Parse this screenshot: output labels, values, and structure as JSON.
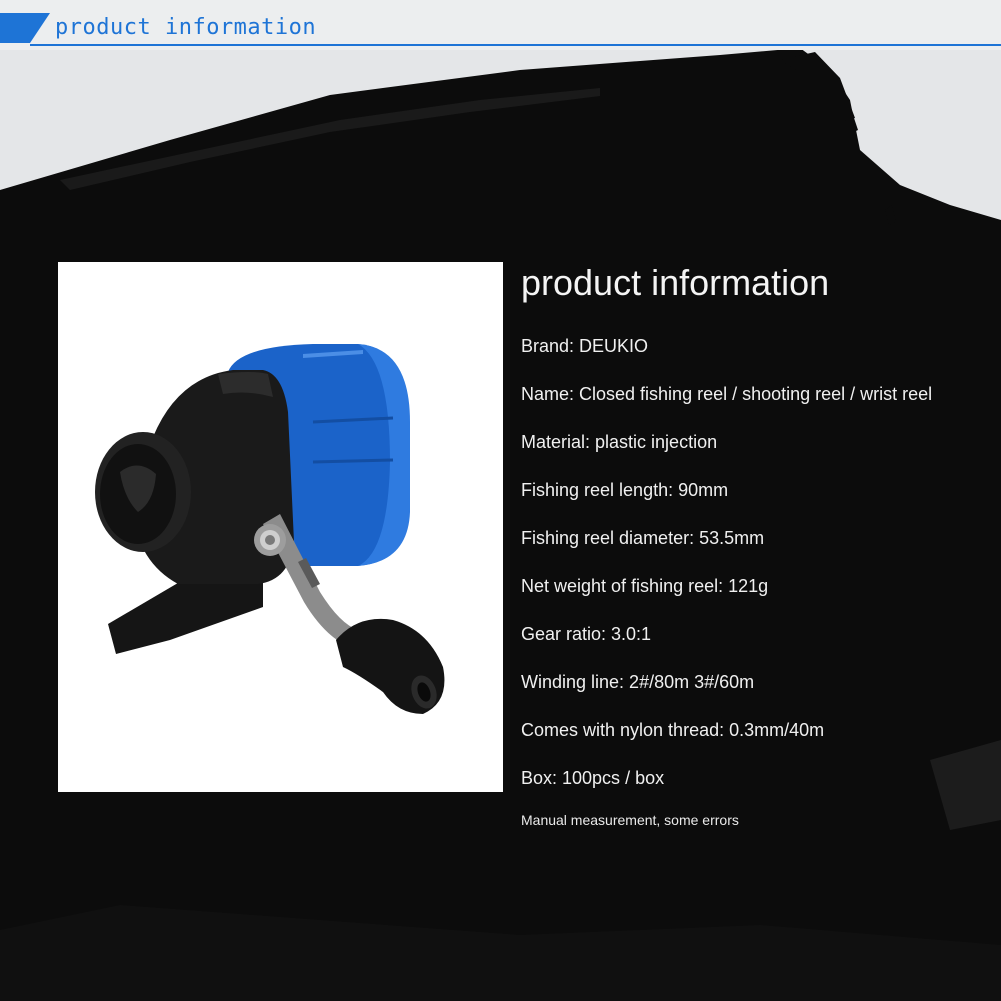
{
  "header": {
    "title": "product information"
  },
  "colors": {
    "accent": "#1e74d6",
    "ink": "#0c0c0c",
    "paper": "#e4e6e8",
    "reel_blue": "#1b63c9",
    "reel_black": "#151515",
    "handle_metal": "#8c8c8c"
  },
  "product_image": {
    "icon": "fishing-reel-photo"
  },
  "info": {
    "title": "product information",
    "specs": [
      "Brand: DEUKIO",
      "Name: Closed fishing reel / shooting reel / wrist reel",
      "Material: plastic injection",
      "Fishing reel length: 90mm",
      "Fishing reel diameter: 53.5mm",
      "Net weight of fishing reel: 121g",
      "Gear ratio: 3.0:1",
      "Winding line: 2#/80m 3#/60m",
      "Comes with nylon thread: 0.3mm/40m",
      "Box: 100pcs / box"
    ],
    "note": "Manual measurement, some errors"
  }
}
